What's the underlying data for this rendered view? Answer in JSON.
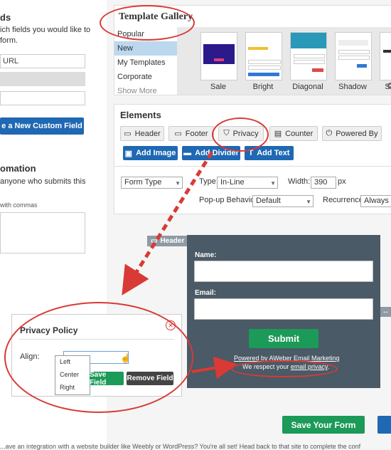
{
  "left": {
    "fields_heading": "ds",
    "fields_desc_1": "ich fields you would like to",
    "fields_desc_2": "form.",
    "url_placeholder": "URL",
    "create_custom_field": "e a New Custom Field",
    "automation_heading": "omation",
    "automation_desc": "anyone who submits this",
    "commas_hint": "with commas"
  },
  "template_gallery": {
    "title": "Template Gallery",
    "items": [
      {
        "label": "Popular"
      },
      {
        "label": "New"
      },
      {
        "label": "My Templates"
      },
      {
        "label": "Corporate"
      },
      {
        "label": "Show More"
      }
    ],
    "thumbnails": [
      {
        "label": "Sale"
      },
      {
        "label": "Bright"
      },
      {
        "label": "Diagonal"
      },
      {
        "label": "Shadow"
      },
      {
        "label": "S"
      }
    ]
  },
  "elements": {
    "title": "Elements",
    "buttons": [
      {
        "label": "Header",
        "icon": "header-icon"
      },
      {
        "label": "Footer",
        "icon": "footer-icon"
      },
      {
        "label": "Privacy",
        "icon": "shield-icon"
      },
      {
        "label": "Counter",
        "icon": "counter-icon"
      },
      {
        "label": "Powered By",
        "icon": "plug-icon"
      }
    ],
    "add_buttons": [
      {
        "label": "Add Image",
        "icon": "image-icon"
      },
      {
        "label": "Add Divider",
        "icon": "divider-icon"
      },
      {
        "label": "Add Text",
        "icon": "text-icon"
      }
    ]
  },
  "settings": {
    "form_type": "Form Type",
    "type_label": "Type:",
    "type_value": "In-Line",
    "width_label": "Width:",
    "width_value": "390",
    "width_unit": "px",
    "popup_label": "Pop-up Behavior:",
    "popup_value": "Default",
    "recurrence_label": "Recurrence:",
    "recurrence_value": "Always D"
  },
  "form_preview": {
    "header_tag": "Header",
    "name_label": "Name:",
    "email_label": "Email:",
    "submit_label": "Submit",
    "powered_by": "Powered by AWeber Email Marketing",
    "privacy_text": "We respect your ",
    "privacy_link": "email privacy",
    "privacy_end": "."
  },
  "privacy_popup": {
    "title": "Privacy Policy",
    "align_label": "Align:",
    "options": [
      "Left",
      "Center",
      "Right"
    ],
    "save_field": "Save Field",
    "remove_field": "Remove Field"
  },
  "footer": {
    "save_form": "Save Your Form",
    "bottom_text": "...ave an integration with a website builder like Weebly or WordPress? You're all set! Head back to that site to complete the conf"
  },
  "colors": {
    "accent_blue": "#1f68b3",
    "green": "#1b9a58",
    "annotation_red": "#d93a35",
    "form_bg": "#4a5a66"
  }
}
